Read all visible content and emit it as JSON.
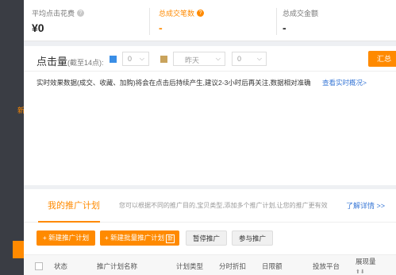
{
  "sidebar": {
    "label": "新"
  },
  "stats": [
    {
      "label": "平均点击花费",
      "value": "¥0"
    },
    {
      "label": "总成交笔数",
      "value": "-"
    },
    {
      "label": "总成交金额",
      "value": "-"
    }
  ],
  "clicks": {
    "title": "点击量",
    "subtitle": "(截至14点):",
    "series_a_value": "0",
    "series_b_period": "昨天",
    "series_b_value": "0",
    "summary_button": "汇总",
    "colors": {
      "series_a": "#3a8ee6",
      "series_b": "#c9a35c",
      "accent": "#ff8a00"
    },
    "notice": "实时效果数据(成交、收藏、加购)将会在点击后持续产生,建议2-3小时后再关注,数据相对准确",
    "notice_link": "查看实时概况>"
  },
  "plans": {
    "tab_label": "我的推广计划",
    "description": "您可以根据不同的推广目的,宝贝类型,添加多个推广计划,让您的推广更有效",
    "more_link": "了解详情 >>",
    "buttons": {
      "new_plan": "+ 新建推广计划",
      "new_batch_plan": "+ 新建批量推广计划",
      "new_tag": "新",
      "pause": "暂停推广",
      "join": "参与推广"
    },
    "columns": [
      "状态",
      "推广计划名称",
      "计划类型",
      "分时折扣",
      "日限额",
      "投放平台",
      "展现量"
    ]
  }
}
